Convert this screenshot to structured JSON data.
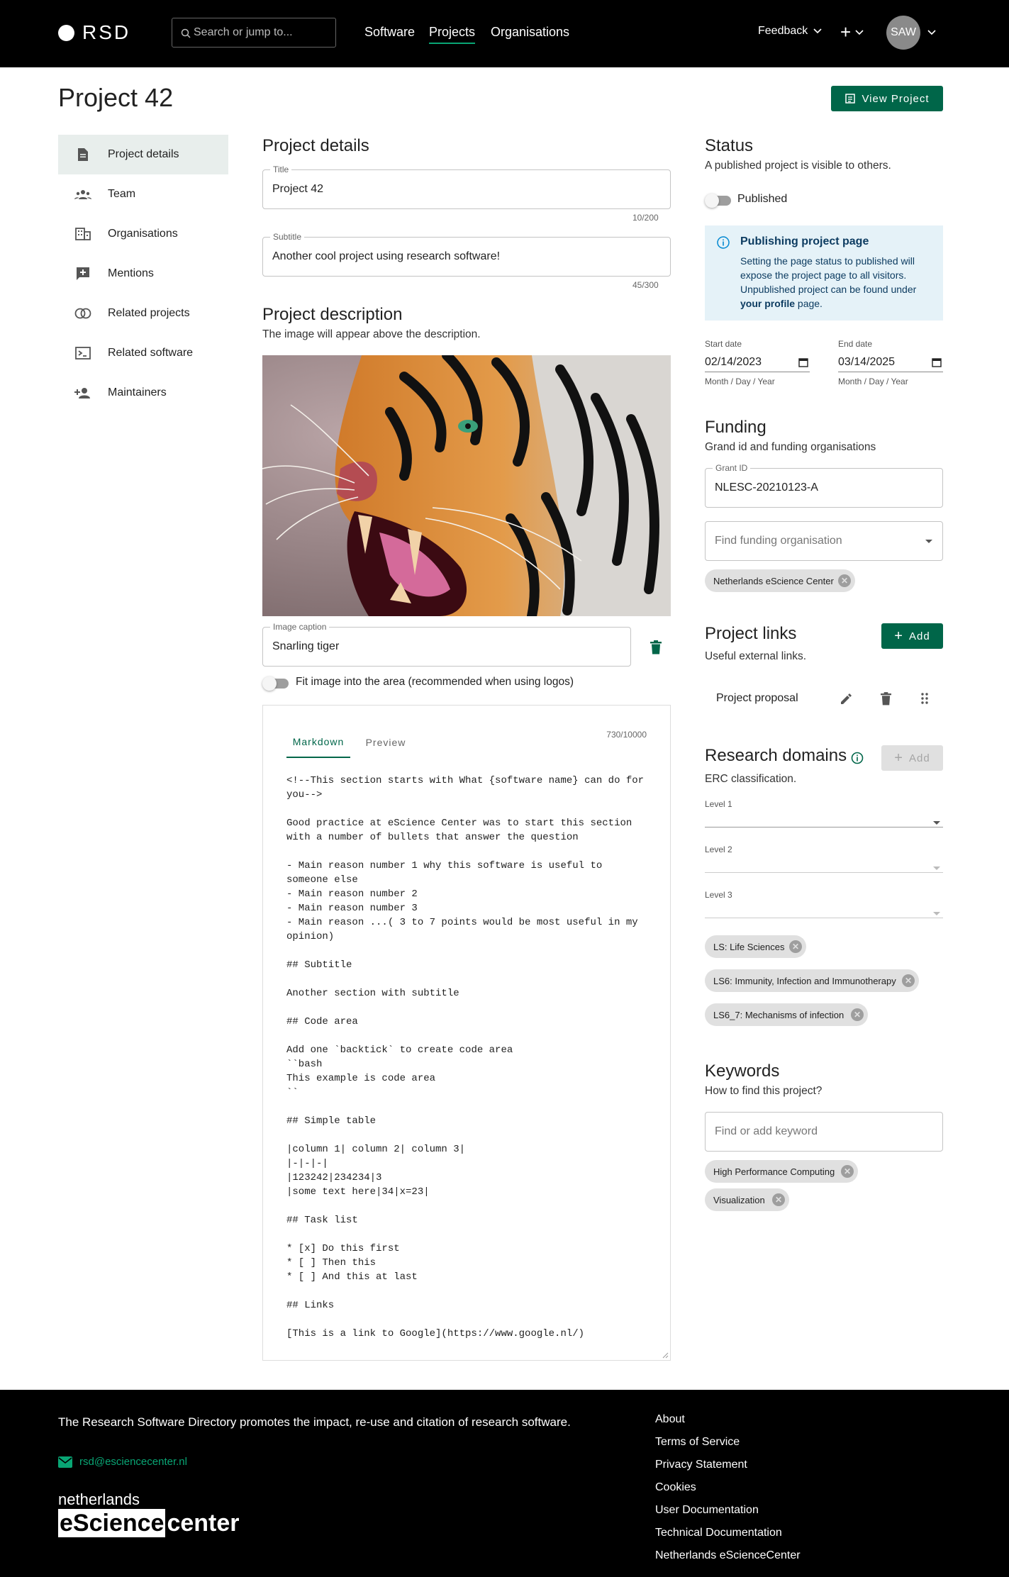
{
  "header": {
    "logo": "RSD",
    "search_placeholder": "Search or jump to...",
    "nav": [
      "Software",
      "Projects",
      "Organisations"
    ],
    "feedback": "Feedback",
    "plus": "+",
    "avatar": "SAW"
  },
  "page": {
    "title": "Project 42",
    "view_button": "View Project"
  },
  "sidebar": {
    "items": [
      {
        "label": "Project details",
        "icon": "document-icon"
      },
      {
        "label": "Team",
        "icon": "team-icon"
      },
      {
        "label": "Organisations",
        "icon": "building-icon"
      },
      {
        "label": "Mentions",
        "icon": "mention-icon"
      },
      {
        "label": "Related projects",
        "icon": "circles-icon"
      },
      {
        "label": "Related software",
        "icon": "terminal-icon"
      },
      {
        "label": "Maintainers",
        "icon": "person-add-icon"
      }
    ]
  },
  "details": {
    "heading": "Project details",
    "title_label": "Title",
    "title_value": "Project 42",
    "title_counter": "10/200",
    "subtitle_label": "Subtitle",
    "subtitle_value": "Another cool project using research software!",
    "subtitle_counter": "45/300"
  },
  "description": {
    "heading": "Project description",
    "sub": "The image will appear above the description.",
    "caption_label": "Image caption",
    "caption_value": "Snarling tiger",
    "fit_label": "Fit image into the area (recommended when using logos)",
    "tabs": [
      "Markdown",
      "Preview"
    ],
    "counter": "730/10000",
    "markdown": "<!--This section starts with What {software name} can do for\nyou-->\n\nGood practice at eScience Center was to start this section\nwith a number of bullets that answer the question\n\n- Main reason number 1 why this software is useful to\nsomeone else\n- Main reason number 2\n- Main reason number 3\n- Main reason ...( 3 to 7 points would be most useful in my\nopinion)\n\n## Subtitle\n\nAnother section with subtitle\n\n## Code area\n\nAdd one `backtick` to create code area\n``bash\nThis example is code area\n``\n\n## Simple table\n\n|column 1| column 2| column 3|\n|-|-|-|\n|123242|234234|3\n|some text here|34|x=23|\n\n## Task list\n\n* [x] Do this first\n* [ ] Then this\n* [ ] And this at last\n\n## Links\n\n[This is a link to Google](https://www.google.nl/)"
  },
  "status": {
    "heading": "Status",
    "sub": "A published project is visible to others.",
    "published_label": "Published",
    "info_title": "Publishing project page",
    "info_text": "Setting the page status to published will expose the project page to all visitors. Unpublished project can be found under",
    "info_link": "your profile",
    "info_tail": "page.",
    "start_label": "Start date",
    "start_value": "02/14/2023",
    "end_label": "End date",
    "end_value": "03/14/2025",
    "date_hint": "Month / Day / Year"
  },
  "funding": {
    "heading": "Funding",
    "sub": "Grand id and funding organisations",
    "grant_label": "Grant ID",
    "grant_value": "NLESC-20210123-A",
    "find_placeholder": "Find funding organisation",
    "chips": [
      "Netherlands eScience Center"
    ]
  },
  "links": {
    "heading": "Project links",
    "add": "Add",
    "sub": "Useful external links.",
    "items": [
      "Project proposal"
    ]
  },
  "domains": {
    "heading": "Research domains",
    "add": "Add",
    "sub": "ERC classification.",
    "levels": [
      "Level 1",
      "Level 2",
      "Level 3"
    ],
    "chips": [
      "LS: Life Sciences",
      "LS6: Immunity, Infection and Immunotherapy",
      "LS6_7: Mechanisms of infection"
    ]
  },
  "keywords": {
    "heading": "Keywords",
    "sub": "How to find this project?",
    "placeholder": "Find or add keyword",
    "chips": [
      "High Performance Computing",
      "Visualization"
    ]
  },
  "footer": {
    "tagline": "The Research Software Directory promotes the impact, re-use and citation of research software.",
    "email": "rsd@esciencecenter.nl",
    "logo_top": "netherlands",
    "logo_left": "eScience",
    "logo_right": "center",
    "links": [
      "About",
      "Terms of Service",
      "Privacy Statement",
      "Cookies",
      "User Documentation",
      "Technical Documentation",
      "Netherlands eScienceCenter"
    ]
  },
  "colors": {
    "brand_green": "#006649",
    "accent": "#09a574",
    "info_bg": "#e5f2f8"
  }
}
